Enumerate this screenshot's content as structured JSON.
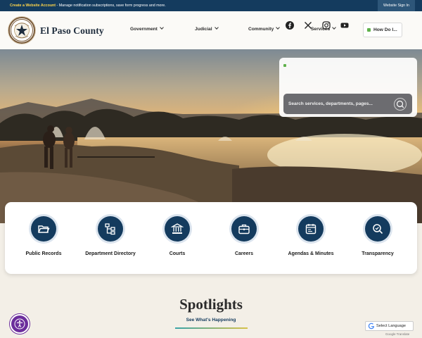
{
  "topbar": {
    "link_text": "Create a Website Account",
    "message": " - Manage notification subscriptions, save form progress and more.",
    "signin_label": "Website Sign In"
  },
  "header": {
    "site_title": "El Paso County",
    "seal_text": "EL PASO COUNTY TEXAS",
    "nav": [
      {
        "label": "Government"
      },
      {
        "label": "Judicial"
      },
      {
        "label": "Community"
      },
      {
        "label": "Services"
      }
    ],
    "how_do_i": "How Do I..."
  },
  "social": {
    "icons": [
      "facebook-icon",
      "x-icon",
      "instagram-icon",
      "youtube-icon"
    ]
  },
  "search": {
    "placeholder": "Search services, departments, pages..."
  },
  "quick_links": [
    {
      "label": "Public Records",
      "icon": "folder-open-icon"
    },
    {
      "label": "Department Directory",
      "icon": "org-chart-icon"
    },
    {
      "label": "Courts",
      "icon": "courthouse-icon"
    },
    {
      "label": "Careers",
      "icon": "briefcase-icon"
    },
    {
      "label": "Agendas & Minutes",
      "icon": "calendar-icon"
    },
    {
      "label": "Transparency",
      "icon": "magnifier-icon"
    }
  ],
  "spotlights": {
    "title": "Spotlights",
    "subtitle": "See What's Happening"
  },
  "translate": {
    "label": "Select Language",
    "powered_by": "Google Translate"
  },
  "colors": {
    "navy": "#143b5e",
    "accent_green": "#5fb14b",
    "accessibility_purple": "#6b2d9c",
    "highlight_yellow": "#ffd54a"
  }
}
